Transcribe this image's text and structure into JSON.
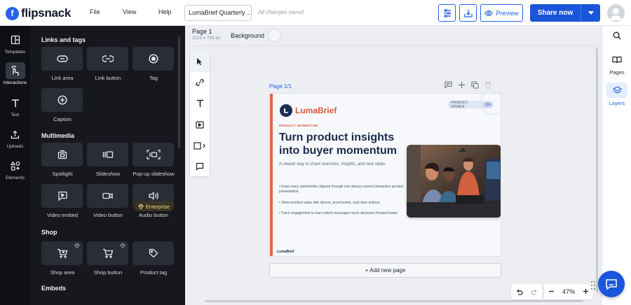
{
  "app": {
    "brand": "flipsnack"
  },
  "menu": {
    "file": "File",
    "view": "View",
    "help": "Help"
  },
  "document": {
    "title": "LumaBrief Quarterly ...",
    "save_status": "All changes saved"
  },
  "header": {
    "preview_label": "Preview",
    "share_label": "Share now"
  },
  "rail": {
    "templates": "Templates",
    "interactions": "Interactions",
    "text": "Text",
    "uploads": "Uploads",
    "elements": "Elements"
  },
  "panel": {
    "sections": {
      "links": "Links and tags",
      "multimedia": "Multimedia",
      "shop": "Shop",
      "embeds": "Embeds"
    },
    "enterprise_badge": "Enterprise",
    "items": {
      "link_area": "Link area",
      "link_button": "Link button",
      "tag": "Tag",
      "caption": "Caption",
      "spotlight": "Spotlight",
      "slideshow": "Slideshow",
      "popup_slideshow": "Pop-up slideshow",
      "video_embed": "Video embed",
      "video_button": "Video button",
      "audio_button": "Audio button",
      "shop_area": "Shop area",
      "shop_button": "Shop button",
      "product_tag": "Product tag"
    }
  },
  "canvas": {
    "page_title": "Page 1",
    "page_size": "1123 x 793 px",
    "background_label": "Background",
    "page_label": "Page 1/1",
    "add_page": "+ Add new page",
    "zoom": "47%"
  },
  "page_content": {
    "brand": "LumaBrief",
    "pill": "PRODUCT UPDATE",
    "pill_tag": "Q4",
    "kicker": "PRODUCT MOMENTUM",
    "headline": "Turn product insights into buyer momentum",
    "subtitle": "A clearer way to share launches, insights, and next steps.",
    "bullets": [
      "• Keep every stakeholder aligned through one always-current interactive product presentation.",
      "• Show product value with demos, proof points, and clear actions.",
      "• Track engagement to learn which messages move decisions forward faster."
    ],
    "footer_brand": "LumaBrief"
  },
  "right_rail": {
    "pages": "Pages",
    "layers": "Layers"
  },
  "colors": {
    "accent": "#1a56db",
    "brand_orange": "#d65b3a",
    "panel_bg": "#16181d"
  }
}
